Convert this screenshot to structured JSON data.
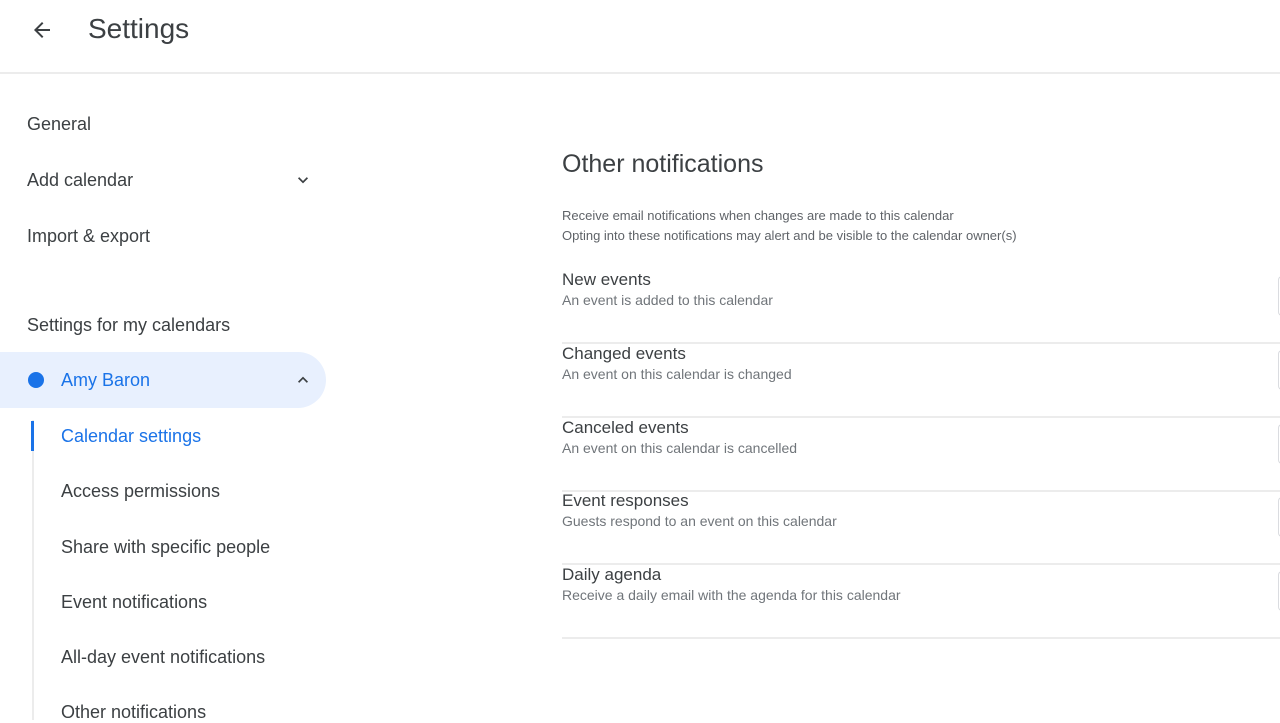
{
  "header": {
    "title": "Settings",
    "back_icon": "arrow-back-icon"
  },
  "sidebar": {
    "general": "General",
    "add_calendar": "Add calendar",
    "import_export": "Import & export",
    "section_heading": "Settings for my calendars",
    "calendar": {
      "name": "Amy Baron",
      "color": "#1a73e8",
      "expanded": true
    },
    "sub_items": [
      {
        "label": "Calendar settings",
        "active": true
      },
      {
        "label": "Access permissions",
        "active": false
      },
      {
        "label": "Share with specific people",
        "active": false
      },
      {
        "label": "Event notifications",
        "active": false
      },
      {
        "label": "All-day event notifications",
        "active": false
      },
      {
        "label": "Other notifications",
        "active": false
      }
    ]
  },
  "main": {
    "title": "Other notifications",
    "description_line1": "Receive email notifications when changes are made to this calendar",
    "description_line2": "Opting into these notifications may alert and be visible to the calendar owner(s)",
    "notifications": [
      {
        "title": "New events",
        "subtitle": "An event is added to this calendar"
      },
      {
        "title": "Changed events",
        "subtitle": "An event on this calendar is changed"
      },
      {
        "title": "Canceled events",
        "subtitle": "An event on this calendar is cancelled"
      },
      {
        "title": "Event responses",
        "subtitle": "Guests respond to an event on this calendar"
      },
      {
        "title": "Daily agenda",
        "subtitle": "Receive a daily email with the agenda for this calendar"
      }
    ]
  },
  "colors": {
    "accent": "#1a73e8",
    "active_bg": "#e8f0fe",
    "text": "#3c4043",
    "subtext": "#70757a",
    "divider": "#ececec"
  }
}
